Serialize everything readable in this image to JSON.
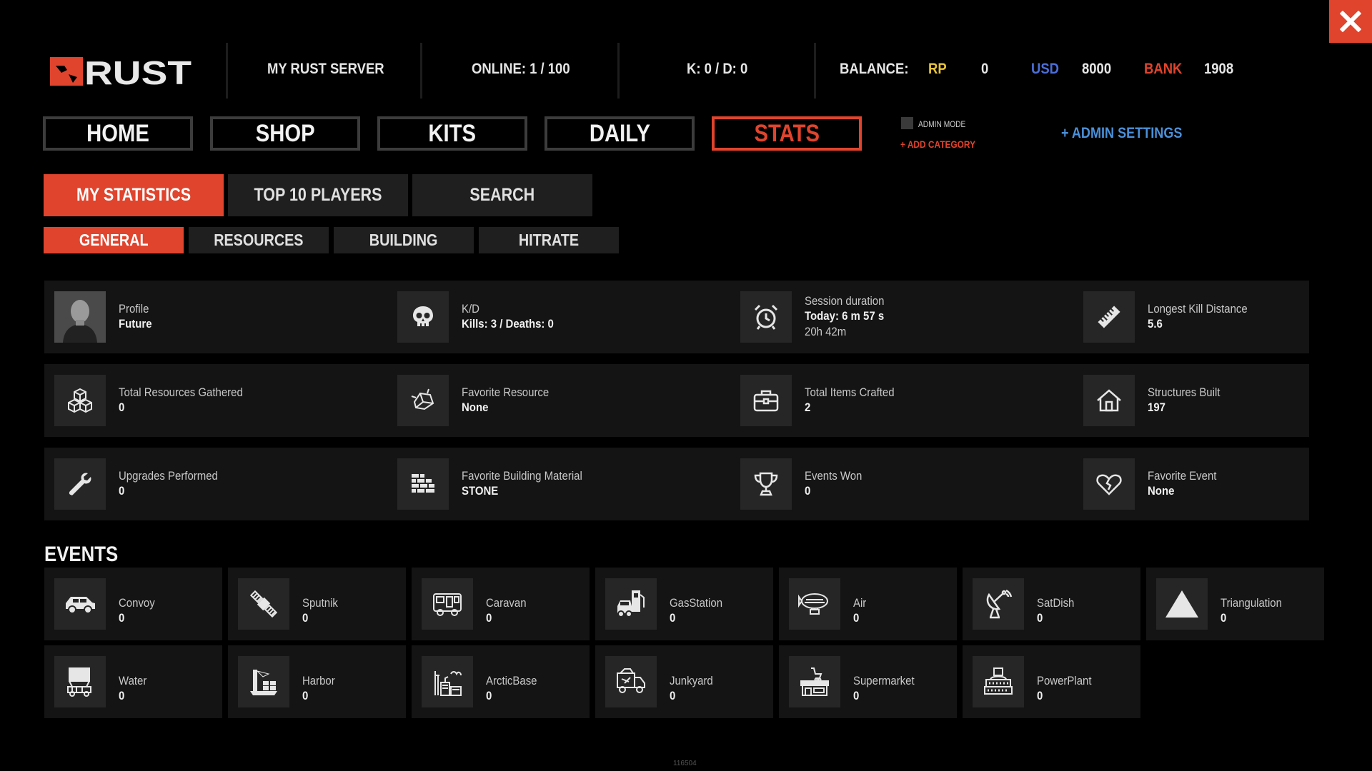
{
  "header": {
    "logo_text": "RUST",
    "server_name": "MY RUST SERVER",
    "online": "ONLINE: 1 / 100",
    "kd": "K: 0  / D: 0",
    "balance_label": "BALANCE:",
    "rp_label": "RP",
    "rp_value": "0",
    "usd_label": "USD",
    "usd_value": "8000",
    "bank_label": "BANK",
    "bank_value": "1908"
  },
  "colors": {
    "accent": "#e0442d",
    "rp": "#e8c53a",
    "usd": "#4a6fd9",
    "bank": "#e0442d",
    "admin": "#4a90d9"
  },
  "nav": {
    "tabs": [
      {
        "label": "HOME"
      },
      {
        "label": "SHOP"
      },
      {
        "label": "KITS"
      },
      {
        "label": "DAILY"
      },
      {
        "label": "STATS",
        "active": true
      }
    ],
    "admin_mode": "ADMIN MODE",
    "add_category": "+ ADD CATEGORY",
    "admin_settings": "+ ADMIN SETTINGS"
  },
  "subtabs": [
    {
      "label": "MY STATISTICS",
      "active": true
    },
    {
      "label": "TOP 10 PLAYERS"
    },
    {
      "label": "SEARCH"
    }
  ],
  "subtabs2": [
    {
      "label": "GENERAL",
      "active": true
    },
    {
      "label": "RESOURCES"
    },
    {
      "label": "BUILDING"
    },
    {
      "label": "HITRATE"
    }
  ],
  "stats": {
    "profile": {
      "label": "Profile",
      "value": "Future",
      "icon": "avatar"
    },
    "kd": {
      "label": "K/D",
      "value": "Kills: 3 / Deaths: 0",
      "icon": "skull-icon"
    },
    "session": {
      "label": "Session duration",
      "value": "Today: 6 m 57 s",
      "value2": "20h 42m",
      "icon": "alarm-clock-icon"
    },
    "longest_kill": {
      "label": "Longest Kill Distance",
      "value": "5.6",
      "icon": "ruler-icon"
    },
    "resources": {
      "label": "Total Resources Gathered",
      "value": "0",
      "icon": "cubes-icon"
    },
    "fav_resource": {
      "label": "Favorite Resource",
      "value": "None",
      "icon": "ore-icon"
    },
    "crafted": {
      "label": "Total Items Crafted",
      "value": "2",
      "icon": "toolbox-icon"
    },
    "structures": {
      "label": "Structures Built",
      "value": "197",
      "icon": "house-icon"
    },
    "upgrades": {
      "label": "Upgrades Performed",
      "value": "0",
      "icon": "wrench-icon"
    },
    "fav_material": {
      "label": "Favorite Building Material",
      "value": "STONE",
      "icon": "bricks-icon"
    },
    "events_won": {
      "label": "Events Won",
      "value": "0",
      "icon": "trophy-icon"
    },
    "fav_event": {
      "label": "Favorite Event",
      "value": "None",
      "icon": "broken-heart-icon"
    }
  },
  "events_title": "EVENTS",
  "events": [
    {
      "name": "Convoy",
      "value": "0",
      "icon": "car-icon"
    },
    {
      "name": "Sputnik",
      "value": "0",
      "icon": "satellite-icon"
    },
    {
      "name": "Caravan",
      "value": "0",
      "icon": "caravan-icon"
    },
    {
      "name": "GasStation",
      "value": "0",
      "icon": "gas-station-icon"
    },
    {
      "name": "Air",
      "value": "0",
      "icon": "airship-icon"
    },
    {
      "name": "SatDish",
      "value": "0",
      "icon": "satellite-dish-icon"
    },
    {
      "name": "Triangulation",
      "value": "0",
      "icon": "triangle-icon"
    },
    {
      "name": "Water",
      "value": "0",
      "icon": "water-tower-icon"
    },
    {
      "name": "Harbor",
      "value": "0",
      "icon": "harbor-icon"
    },
    {
      "name": "ArcticBase",
      "value": "0",
      "icon": "arctic-base-icon"
    },
    {
      "name": "Junkyard",
      "value": "0",
      "icon": "truck-icon"
    },
    {
      "name": "Supermarket",
      "value": "0",
      "icon": "supermarket-icon"
    },
    {
      "name": "PowerPlant",
      "value": "0",
      "icon": "power-plant-icon"
    }
  ],
  "footer_id": "116504"
}
